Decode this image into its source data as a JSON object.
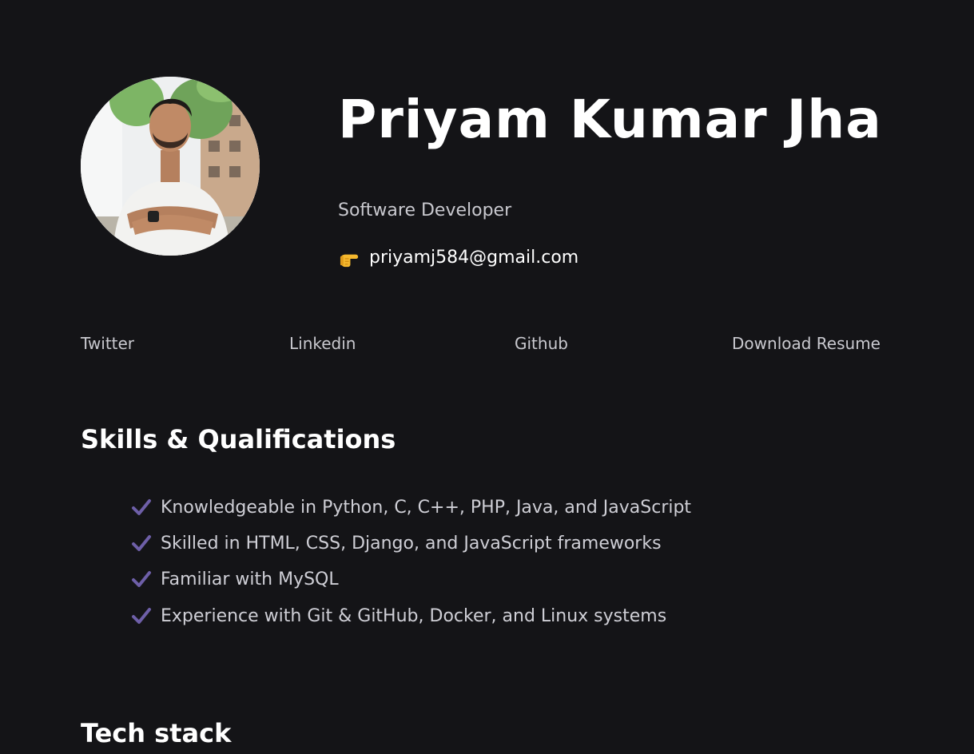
{
  "profile": {
    "name": "Priyam Kumar Jha",
    "role": "Software Developer",
    "email": "priyamj584@gmail.com",
    "email_icon": "pointing-hand-icon"
  },
  "links": {
    "twitter": "Twitter",
    "linkedin": "Linkedin",
    "github": "Github",
    "resume": "Download Resume"
  },
  "skills": {
    "title": "Skills & Qualifications",
    "icon": "checkmark-icon",
    "accent": "#6e5fa8",
    "items": [
      "Knowledgeable in Python, C, C++, PHP, Java, and JavaScript",
      "Skilled in HTML, CSS, Django, and JavaScript frameworks",
      "Familiar with MySQL",
      "Experience with Git & GitHub, Docker, and Linux systems"
    ]
  },
  "tech_stack": {
    "title": "Tech stack"
  },
  "colors": {
    "background": "#141417",
    "text_primary": "#ffffff",
    "text_muted": "#c9c9cf"
  }
}
